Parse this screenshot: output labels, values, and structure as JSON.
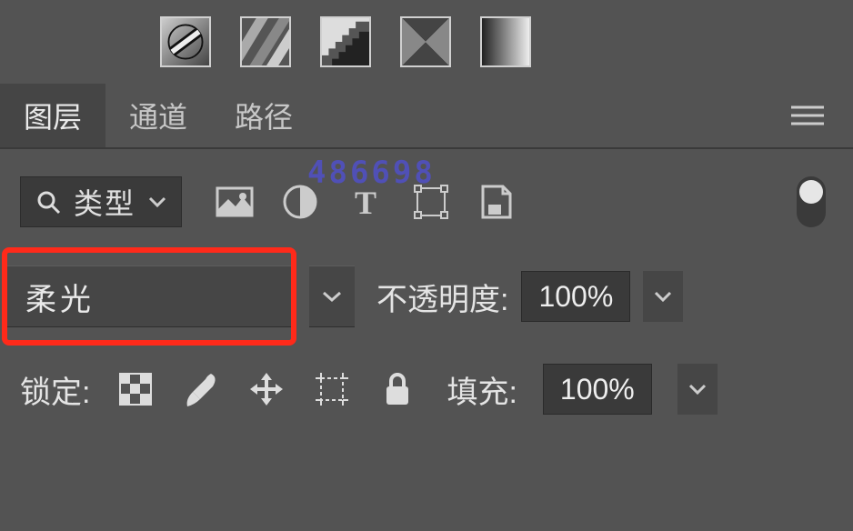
{
  "tabs": {
    "layers": "图层",
    "channels": "通道",
    "paths": "路径"
  },
  "filter": {
    "label": "类型"
  },
  "watermark": "486698",
  "blend": {
    "mode": "柔光",
    "opacity_label": "不透明度:",
    "opacity_value": "100%"
  },
  "lock": {
    "label": "锁定:",
    "fill_label": "填充:",
    "fill_value": "100%"
  },
  "icons": {
    "thumb1": "gradient-map-thumb",
    "thumb2": "stripes-thumb",
    "thumb3": "jagged-thumb",
    "thumb4": "triangle-thumb",
    "thumb5": "gradient-thumb",
    "image": "image-icon",
    "adjustment": "adjustment-icon",
    "text": "text-icon",
    "shape": "shape-icon",
    "smartobj": "smartobject-icon",
    "lock_trans": "lock-transparency-icon",
    "brush": "brush-icon",
    "move": "move-icon",
    "artboard": "artboard-icon",
    "lock_all": "lock-icon"
  }
}
